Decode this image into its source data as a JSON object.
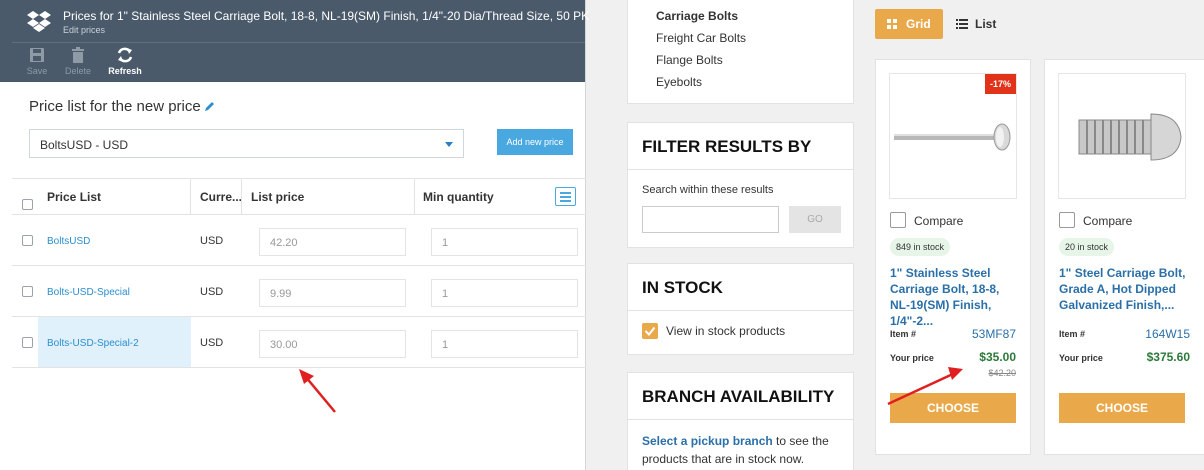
{
  "admin": {
    "title": "Prices for 1\" Stainless Steel Carriage Bolt, 18-8, NL-19(SM) Finish, 1/4\"-20 Dia/Thread Size, 50 PK",
    "subtitle": "Edit prices",
    "toolbar": {
      "save": "Save",
      "delete": "Delete",
      "refresh": "Refresh"
    },
    "price_list_title": "Price list for the new price",
    "price_list_selected": "BoltsUSD - USD",
    "add_new_price": "Add new price",
    "table": {
      "columns": [
        "Price List",
        "Curre...",
        "List price",
        "Min quantity"
      ],
      "rows": [
        {
          "price_list": "BoltsUSD",
          "currency": "USD",
          "list_price": "42.20",
          "min_quantity": "1"
        },
        {
          "price_list": "Bolts-USD-Special",
          "currency": "USD",
          "list_price": "9.99",
          "min_quantity": "1"
        },
        {
          "price_list": "Bolts-USD-Special-2",
          "currency": "USD",
          "list_price": "30.00",
          "min_quantity": "1"
        }
      ]
    }
  },
  "categories": [
    "Carriage Bolts",
    "Freight Car Bolts",
    "Flange Bolts",
    "Eyebolts"
  ],
  "filter": {
    "heading": "FILTER RESULTS BY",
    "search_label": "Search within these results",
    "go": "GO"
  },
  "in_stock": {
    "heading": "IN STOCK",
    "label": "View in stock products"
  },
  "branch": {
    "heading": "BRANCH AVAILABILITY",
    "link": "Select a pickup branch",
    "text": " to see the products that are in stock now."
  },
  "view": {
    "grid": "Grid",
    "list": "List"
  },
  "products": [
    {
      "discount": "-17%",
      "compare": "Compare",
      "stock": "849 in stock",
      "title": "1\" Stainless Steel Carriage Bolt, 18-8, NL-19(SM) Finish, 1/4\"-2...",
      "item_label": "Item #",
      "item": "53MF87",
      "price_label": "Your price",
      "price": "$35.00",
      "old_price": "$42.20",
      "cta": "CHOOSE"
    },
    {
      "compare": "Compare",
      "stock": "20 in stock",
      "title": "1\" Steel Carriage Bolt, Grade A, Hot Dipped Galvanized Finish,...",
      "item_label": "Item #",
      "item": "164W15",
      "price_label": "Your price",
      "price": "$375.60",
      "cta": "CHOOSE"
    }
  ],
  "colors": {
    "admin_header": "#4a5a6b",
    "accent_orange": "#e9a94a",
    "link_blue": "#2a6fa8",
    "price_green": "#2c7a3a",
    "discount_red": "#e0331a",
    "annotation_arrow": "#e02020"
  }
}
